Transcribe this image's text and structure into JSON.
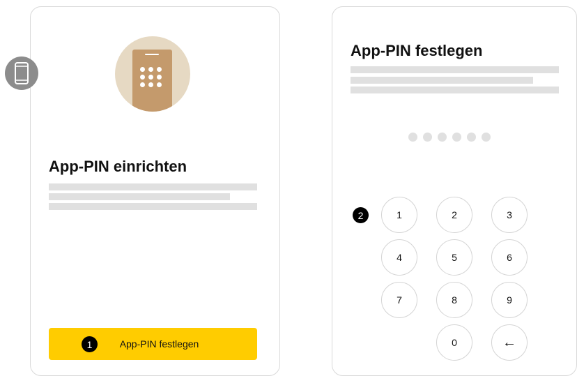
{
  "left_card": {
    "title": "App-PIN einrichten",
    "button_label": "App-PIN festlegen",
    "step_marker": "1"
  },
  "right_card": {
    "title": "App-PIN festlegen",
    "step_marker": "2",
    "pin_length": 6,
    "keypad": [
      "1",
      "2",
      "3",
      "4",
      "5",
      "6",
      "7",
      "8",
      "9",
      "0"
    ],
    "backspace_symbol": "←"
  },
  "icons": {
    "device": "smartphone-icon",
    "hero": "phone-keypad-illustration",
    "backspace": "backspace-arrow-icon"
  },
  "colors": {
    "accent": "#ffcc00",
    "hero_background": "#e6d9c3",
    "hero_phone": "#c49a6c",
    "badge": "#8c8c8c"
  }
}
